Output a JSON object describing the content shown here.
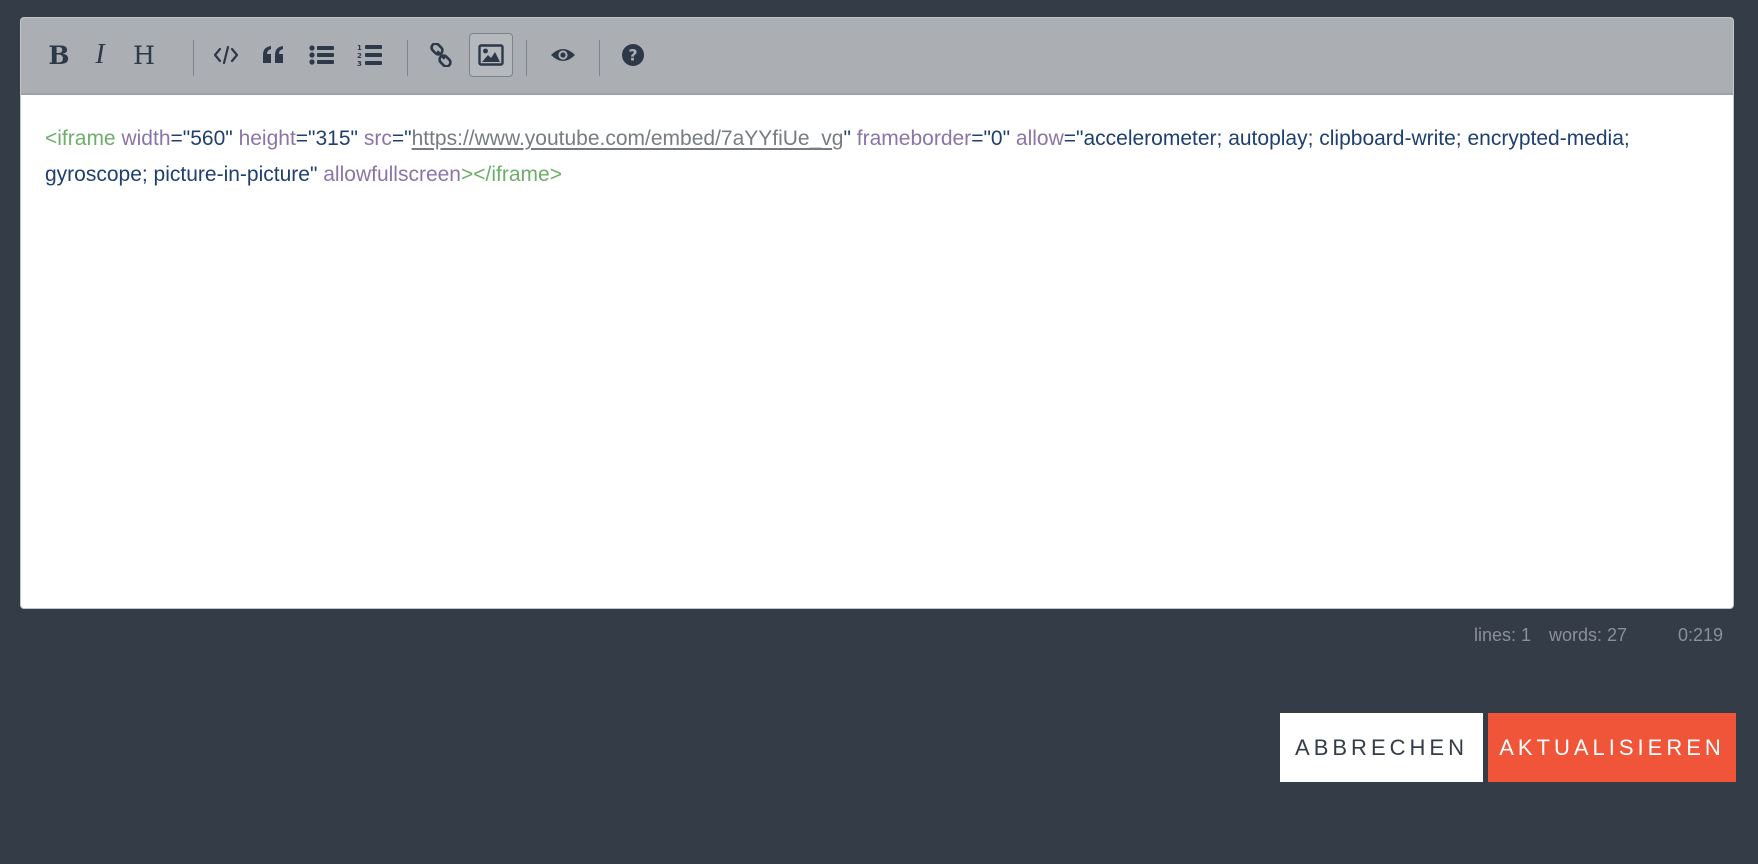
{
  "toolbar": {
    "buttons": [
      {
        "name": "bold",
        "label": "B",
        "icon": "bold-icon"
      },
      {
        "name": "italic",
        "label": "I",
        "icon": "italic-icon"
      },
      {
        "name": "heading",
        "label": "H",
        "icon": "heading-icon"
      },
      {
        "name": "code",
        "icon": "code-icon"
      },
      {
        "name": "quote",
        "icon": "quote-icon"
      },
      {
        "name": "unordered-list",
        "icon": "unordered-list-icon"
      },
      {
        "name": "ordered-list",
        "icon": "ordered-list-icon"
      },
      {
        "name": "link",
        "icon": "link-icon"
      },
      {
        "name": "image",
        "icon": "image-icon",
        "active": true
      },
      {
        "name": "preview",
        "icon": "eye-icon"
      },
      {
        "name": "help",
        "icon": "question-circle-icon"
      }
    ]
  },
  "editor": {
    "code": {
      "open_bracket": "<",
      "tag_name": "iframe",
      "attr_width": "width",
      "eq1": "=",
      "val_width": "\"560\"",
      "attr_height": "height",
      "eq2": "=",
      "val_height": "\"315\"",
      "attr_src": "src",
      "eq3": "=",
      "quote_open_src": "\"",
      "val_src_url": "https://www.youtube.com/embed/7aYYfiUe_vg",
      "quote_close_src": "\"",
      "attr_frameborder": "frameborder",
      "eq4": "=",
      "val_frameborder": "\"0\"",
      "attr_allow": "allow",
      "eq5": "=",
      "val_allow": "\"accelerometer; autoplay; clipboard-write; encrypted-media; gyroscope; picture-in-picture\"",
      "attr_allowfullscreen": "allowfullscreen",
      "close_tag": "></iframe>"
    }
  },
  "statusbar": {
    "lines": "lines: 1",
    "words": "words: 27",
    "cursor": "0:219"
  },
  "actions": {
    "cancel_label": "ABBRECHEN",
    "update_label": "AKTUALISIEREN"
  },
  "colors": {
    "background": "#333c47",
    "toolbar": "#abaeb2",
    "accent": "#f0553a",
    "tag": "#6dae6a",
    "attribute": "#8b75a8",
    "string": "#1f3f6e"
  }
}
